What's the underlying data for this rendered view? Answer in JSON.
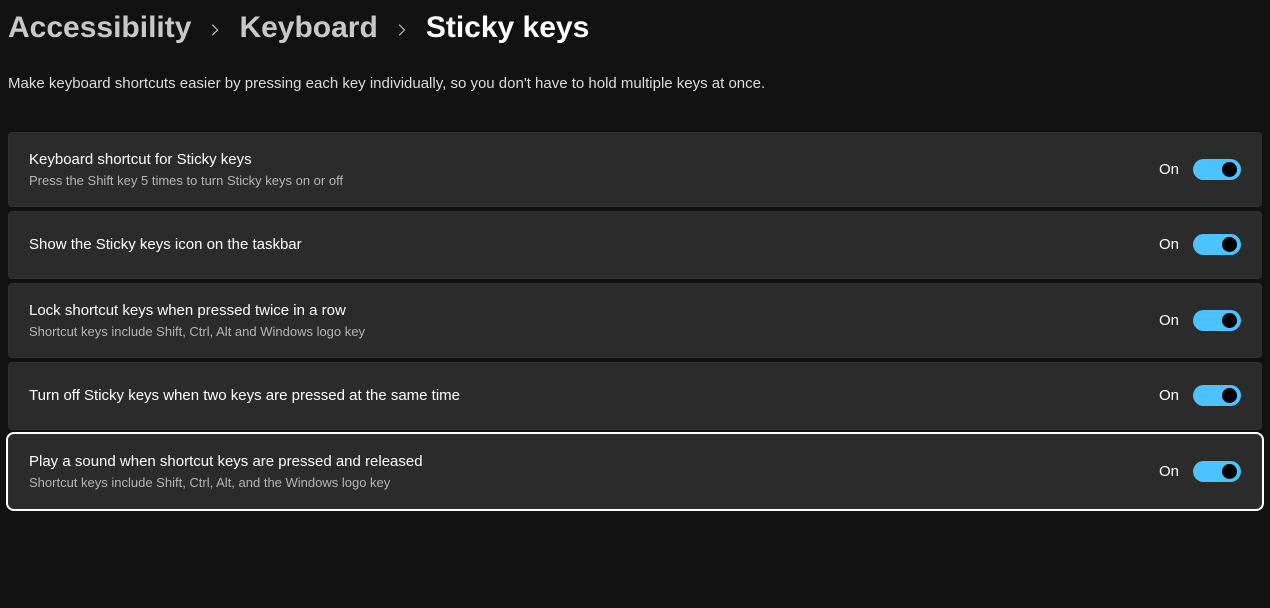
{
  "breadcrumb": {
    "item1": "Accessibility",
    "item2": "Keyboard",
    "current": "Sticky keys"
  },
  "description": "Make keyboard shortcuts easier by pressing each key individually, so you don't have to hold multiple keys at once.",
  "settings": [
    {
      "title": "Keyboard shortcut for Sticky keys",
      "subtitle": "Press the Shift key 5 times to turn Sticky keys on or off",
      "state_label": "On",
      "state": true,
      "focused": false
    },
    {
      "title": "Show the Sticky keys icon on the taskbar",
      "subtitle": "",
      "state_label": "On",
      "state": true,
      "focused": false
    },
    {
      "title": "Lock shortcut keys when pressed twice in a row",
      "subtitle": "Shortcut keys include Shift, Ctrl, Alt and Windows logo key",
      "state_label": "On",
      "state": true,
      "focused": false
    },
    {
      "title": "Turn off Sticky keys when two keys are pressed at the same time",
      "subtitle": "",
      "state_label": "On",
      "state": true,
      "focused": false
    },
    {
      "title": "Play a sound when shortcut keys are pressed and released",
      "subtitle": "Shortcut keys include Shift, Ctrl, Alt, and the Windows logo key",
      "state_label": "On",
      "state": true,
      "focused": true
    }
  ]
}
